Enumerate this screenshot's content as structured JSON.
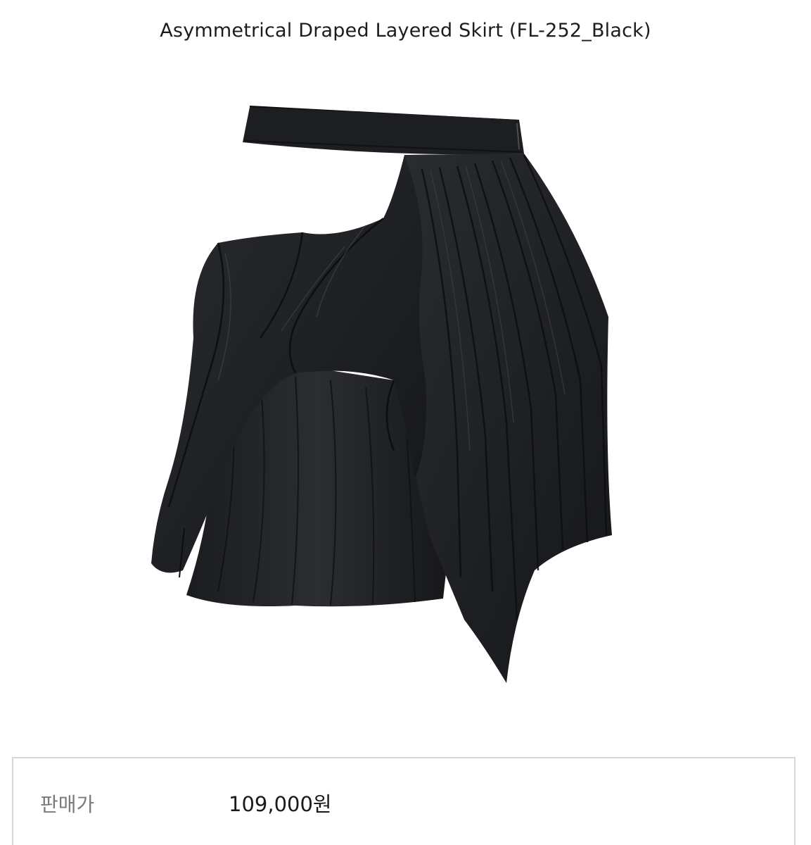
{
  "product": {
    "title": "Asymmetrical Draped Layered Skirt (FL-252_Black)",
    "image_subject": "black asymmetrical draped layered skirt",
    "colors": {
      "fabric": "#1e1f22",
      "fabric_dark": "#0d0e10",
      "fabric_highlight": "#3a3c40",
      "border": "#d7d7d7",
      "label": "#7a7a7a"
    }
  },
  "price": {
    "label": "판매가",
    "value": "109,000원"
  }
}
